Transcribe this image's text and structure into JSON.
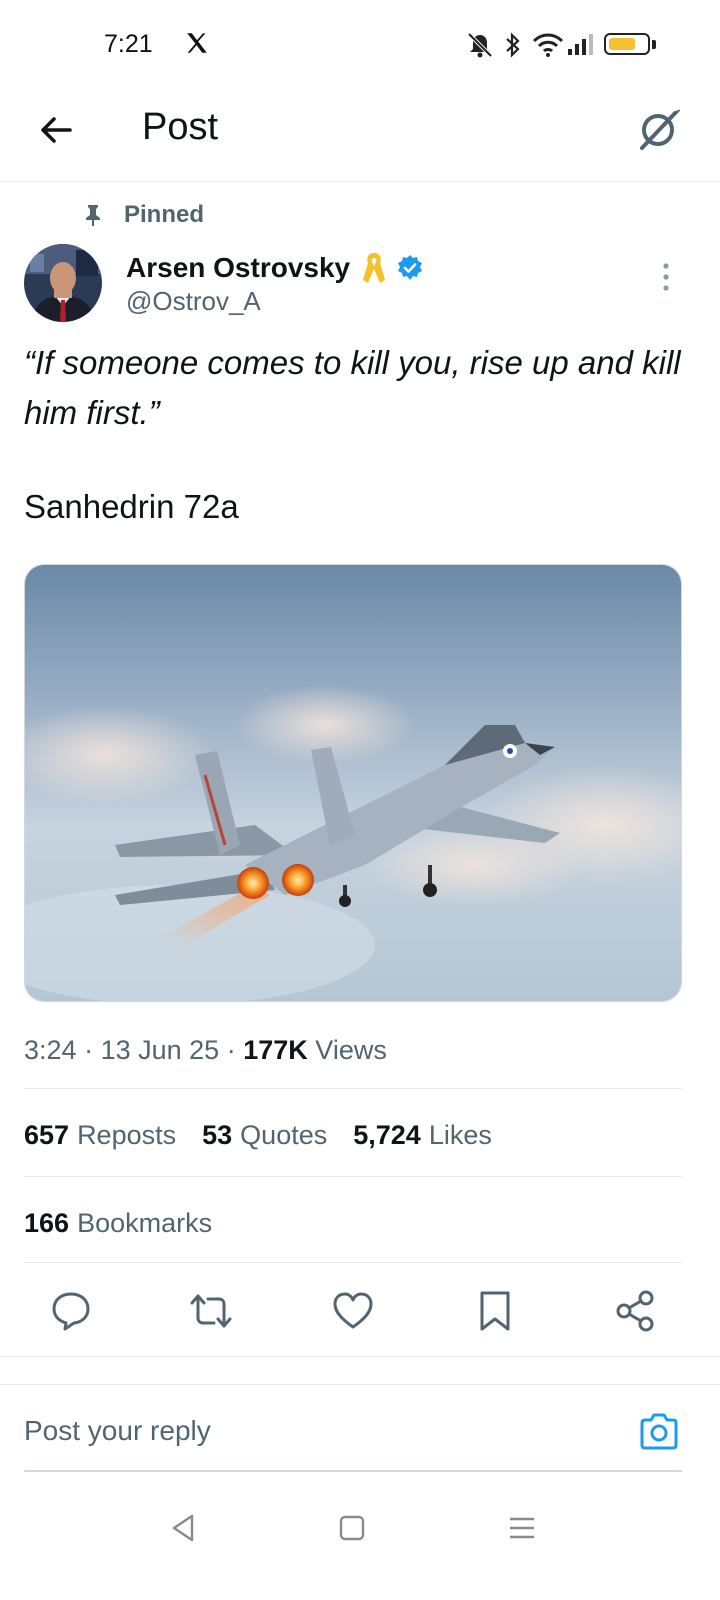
{
  "status_bar": {
    "time": "7:21",
    "app_icon": "x-logo-icon",
    "icons": [
      "mute-bell-icon",
      "bluetooth-icon",
      "wifi-icon",
      "signal-icon",
      "battery-icon"
    ],
    "battery_color": "#f5c033"
  },
  "header": {
    "back_icon": "back-arrow-icon",
    "title": "Post",
    "grok_icon": "grok-icon"
  },
  "post": {
    "pinned_label": "Pinned",
    "author": {
      "name": "Arsen Ostrovsky",
      "handle": "@Ostrov_A",
      "badges": [
        "yellow-ribbon-icon",
        "verified-badge-icon"
      ]
    },
    "quote_text": "“If someone comes to kill you, rise up and kill him first.”",
    "source_text": "Sanhedrin 72a",
    "media_description_icon": "fighter-jet-image",
    "meta": {
      "time": "3:24",
      "sep1": "·",
      "date": "13 Jun 25",
      "sep2": "·",
      "views_count": "177K",
      "views_label": "Views"
    },
    "stats": {
      "reposts_count": "657",
      "reposts_label": "Reposts",
      "quotes_count": "53",
      "quotes_label": "Quotes",
      "likes_count": "5,724",
      "likes_label": "Likes",
      "bookmarks_count": "166",
      "bookmarks_label": "Bookmarks"
    },
    "actions": [
      "reply-icon",
      "repost-icon",
      "like-icon",
      "bookmark-icon",
      "share-icon"
    ]
  },
  "reply": {
    "placeholder": "Post your reply",
    "camera_icon": "camera-icon",
    "accent": "#1d9bf0"
  },
  "navbar": [
    "nav-back-icon",
    "nav-home-icon",
    "nav-menu-icon"
  ]
}
